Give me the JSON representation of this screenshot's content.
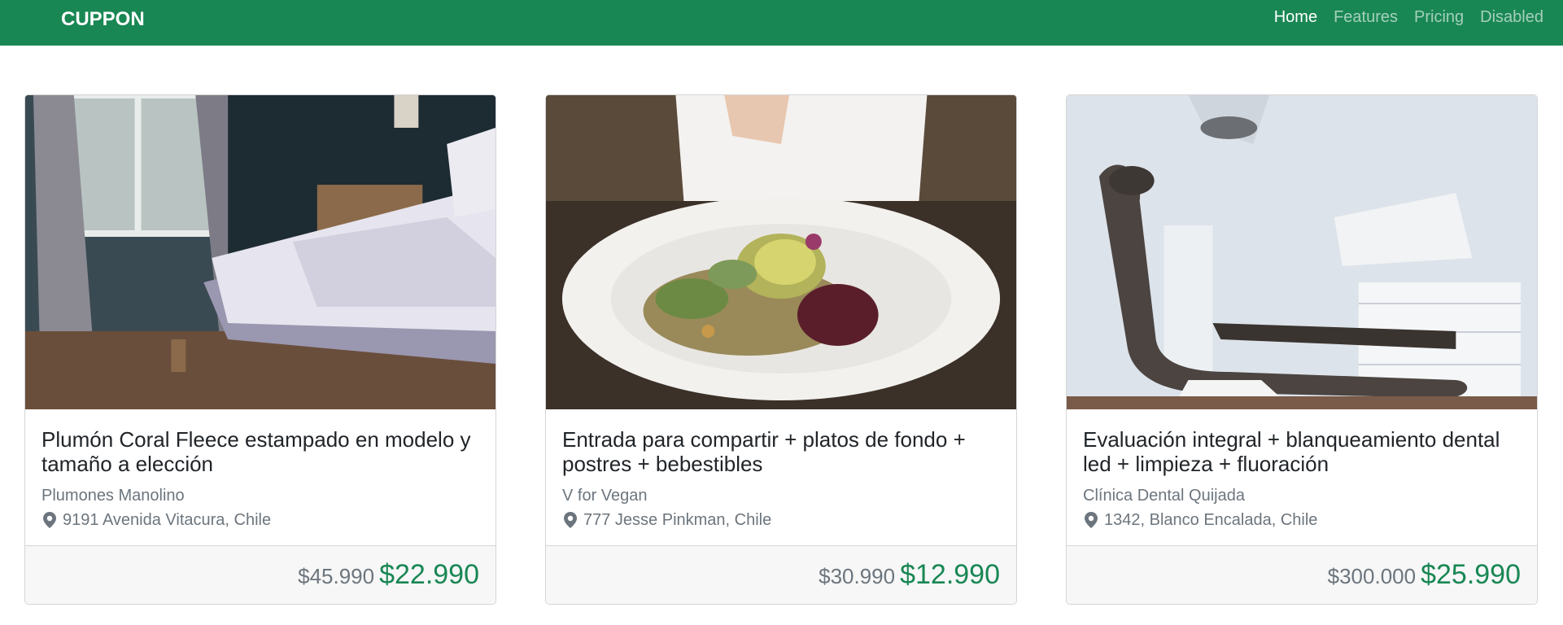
{
  "navbar": {
    "brand": "CUPPON",
    "links": [
      {
        "label": "Home",
        "state": "active"
      },
      {
        "label": "Features",
        "state": "normal"
      },
      {
        "label": "Pricing",
        "state": "normal"
      },
      {
        "label": "Disabled",
        "state": "disabled"
      }
    ]
  },
  "colors": {
    "navbar_bg": "#198754",
    "price_new": "#198754",
    "muted_text": "#6c757d",
    "footer_bg": "#f7f7f7"
  },
  "deals": [
    {
      "image_icon": "bed-photo",
      "title": "Plumón Coral Fleece estampado en modelo y tamaño a elección",
      "merchant": "Plumones Manolino",
      "location_icon": "map-pin-icon",
      "location": "9191 Avenida Vitacura, Chile",
      "price_original": "$45.990",
      "price_discount": "$22.990"
    },
    {
      "image_icon": "salad-plate-photo",
      "title": "Entrada para compartir + platos de fondo + postres + bebestibles",
      "merchant": "V for Vegan",
      "location_icon": "map-pin-icon",
      "location": "777 Jesse Pinkman, Chile",
      "price_original": "$30.990",
      "price_discount": "$12.990"
    },
    {
      "image_icon": "dental-chair-photo",
      "title": "Evaluación integral + blanqueamiento dental led + limpieza + fluoración",
      "merchant": "Clínica Dental Quijada",
      "location_icon": "map-pin-icon",
      "location": "1342, Blanco Encalada, Chile",
      "price_original": "$300.000",
      "price_discount": "$25.990"
    }
  ]
}
